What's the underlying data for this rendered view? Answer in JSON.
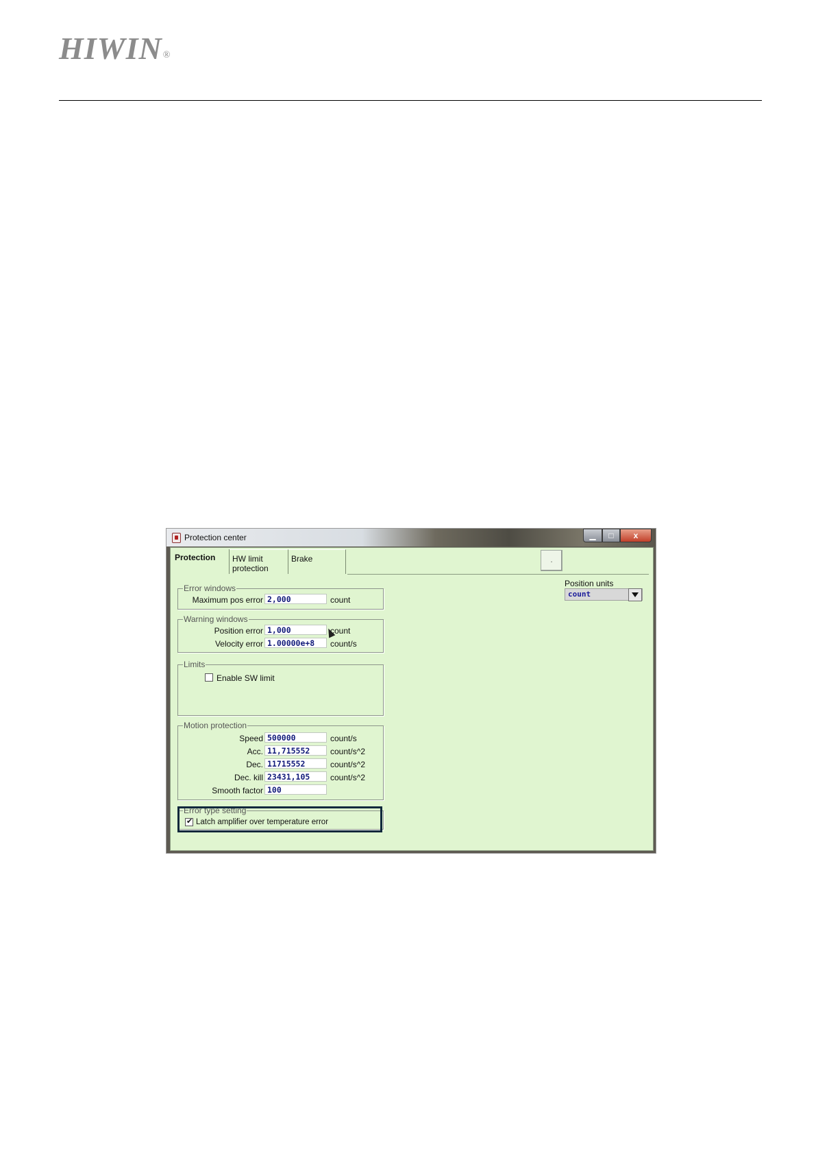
{
  "header": {
    "logo_text": "HIWIN",
    "logo_reg": "®"
  },
  "window": {
    "title": "Protection center",
    "buttons": {
      "minimize": "▁",
      "maximize": "□",
      "close": "x"
    },
    "tabs": [
      {
        "label": "Protection"
      },
      {
        "label": "HW limit protection"
      },
      {
        "label": "Brake"
      }
    ],
    "small_button_label": ".",
    "position_units": {
      "label": "Position units",
      "value": "count"
    },
    "error_windows": {
      "title": "Error windows",
      "rows": [
        {
          "label": "Maximum pos error",
          "value": "2,000",
          "unit": "count"
        }
      ]
    },
    "warning_windows": {
      "title": "Warning windows",
      "rows": [
        {
          "label": "Position error",
          "value": "1,000",
          "unit": "count"
        },
        {
          "label": "Velocity error",
          "value": "1.00000e+8",
          "unit": "count/s"
        }
      ]
    },
    "limits": {
      "title": "Limits",
      "enable_sw_limit": {
        "label": "Enable SW limit",
        "checked": false
      }
    },
    "motion_protection": {
      "title": "Motion protection",
      "rows": [
        {
          "label": "Speed",
          "value": "500000",
          "unit": "count/s"
        },
        {
          "label": "Acc.",
          "value": "11,715552",
          "unit": "count/s^2"
        },
        {
          "label": "Dec.",
          "value": "11715552",
          "unit": "count/s^2"
        },
        {
          "label": "Dec. kill",
          "value": "23431,105",
          "unit": "count/s^2"
        },
        {
          "label": "Smooth factor",
          "value": "100",
          "unit": ""
        }
      ]
    },
    "error_type_setting": {
      "title": "Error type setting",
      "latch": {
        "label": "Latch amplifier over temperature error",
        "checked": true
      }
    }
  }
}
